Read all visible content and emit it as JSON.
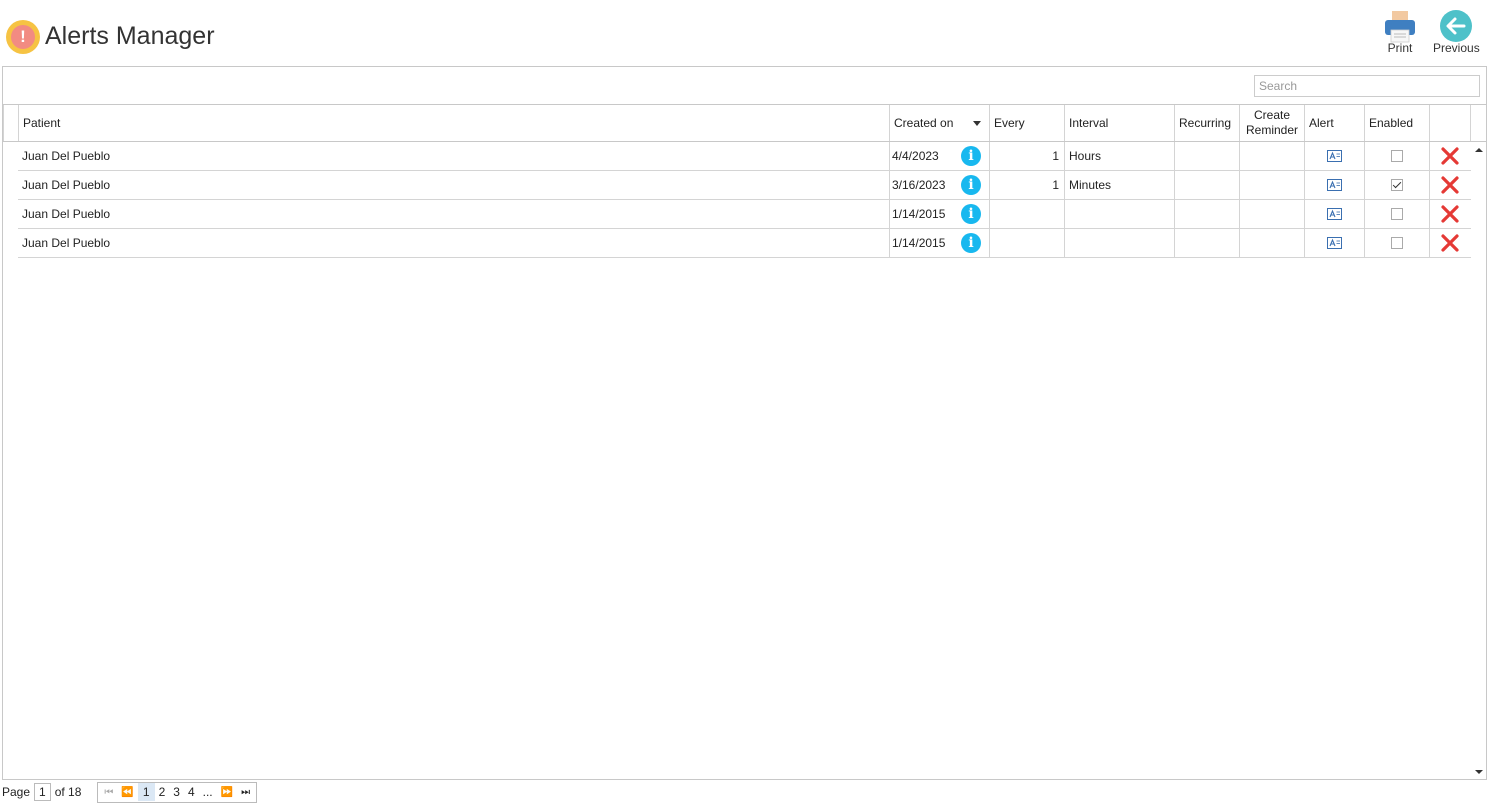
{
  "header": {
    "title": "Alerts Manager",
    "print_label": "Print",
    "previous_label": "Previous"
  },
  "search": {
    "placeholder": "Search",
    "value": ""
  },
  "columns": {
    "patient": "Patient",
    "created_on": "Created on",
    "every": "Every",
    "interval": "Interval",
    "recurring": "Recurring",
    "create_reminder": "Create Reminder",
    "alert": "Alert",
    "enabled": "Enabled"
  },
  "rows": [
    {
      "patient": "Juan Del Pueblo",
      "created_on": "4/4/2023",
      "every": "1",
      "interval": "Hours",
      "enabled": false
    },
    {
      "patient": "Juan Del Pueblo",
      "created_on": "3/16/2023",
      "every": "1",
      "interval": "Minutes",
      "enabled": true
    },
    {
      "patient": "Juan Del Pueblo",
      "created_on": "1/14/2015",
      "every": "",
      "interval": "",
      "enabled": false
    },
    {
      "patient": "Juan Del Pueblo",
      "created_on": "1/14/2015",
      "every": "",
      "interval": "",
      "enabled": false
    }
  ],
  "pager": {
    "page_label": "Page",
    "current_page": "1",
    "of_label": "of 18",
    "pages": [
      "1",
      "2",
      "3",
      "4"
    ],
    "ellipsis": "..."
  },
  "colors": {
    "info": "#18b8ef",
    "delete": "#e53935",
    "accent": "#f6c343"
  },
  "icons": {
    "info": "info-icon",
    "delete": "close-icon",
    "alert": "alert-document-icon"
  }
}
